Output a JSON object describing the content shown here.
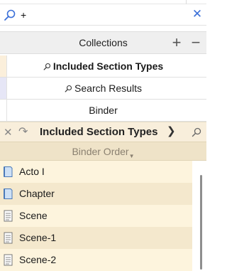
{
  "search": {
    "query": "+"
  },
  "collections": {
    "title": "Collections",
    "rows": [
      {
        "label": "Included Section Types",
        "tab_color": "#fbefdb",
        "has_search_icon": true
      },
      {
        "label": "Search Results",
        "tab_color": "#e6e6f6",
        "has_search_icon": true
      },
      {
        "label": "Binder",
        "tab_color": "#ffffff",
        "has_search_icon": false
      }
    ]
  },
  "binder": {
    "title": "Included Section Types",
    "sort_label": "Binder Order",
    "items": [
      {
        "label": "Acto I",
        "icon": "folder-doc-icon"
      },
      {
        "label": "Chapter",
        "icon": "folder-doc-icon"
      },
      {
        "label": "Scene",
        "icon": "text-doc-icon"
      },
      {
        "label": "Scene-1",
        "icon": "text-doc-icon"
      },
      {
        "label": "Scene-2",
        "icon": "text-doc-icon"
      }
    ]
  },
  "colors": {
    "accent": "#3a6fd8",
    "binder_bg": "#fdf4dd",
    "binder_bg_alt": "#f4e8cd",
    "sort_bar": "#efe3c8"
  }
}
